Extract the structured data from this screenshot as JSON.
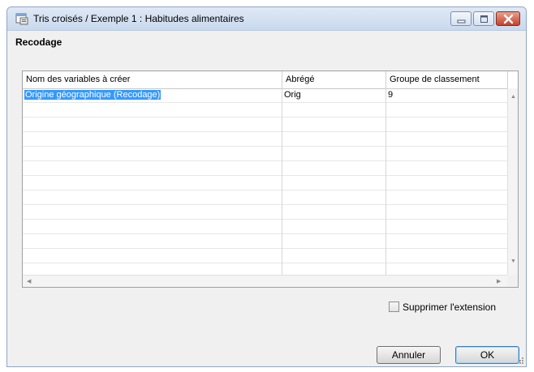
{
  "window": {
    "title": "Tris croisés / Exemple 1 : Habitudes alimentaires"
  },
  "section": {
    "title": "Recodage"
  },
  "table": {
    "columns": [
      "Nom des variables à créer",
      "Abrégé",
      "Groupe de classement"
    ],
    "rows": [
      {
        "name": "Origine géographique (Recodage)",
        "abbr": "Orig",
        "group": "9",
        "selected": true
      }
    ],
    "empty_rows": 12
  },
  "options": {
    "remove_extension_label": "Supprimer l'extension",
    "remove_extension_checked": false
  },
  "buttons": {
    "cancel_label": "Annuler",
    "ok_label": "OK"
  },
  "colors": {
    "selection": "#3399ff",
    "close_button": "#c7412a",
    "titlebar": "#dfe9f5"
  },
  "icons": {
    "app": "app-window-icon",
    "minimize": "minimize-icon",
    "maximize": "maximize-icon",
    "close": "close-icon"
  }
}
